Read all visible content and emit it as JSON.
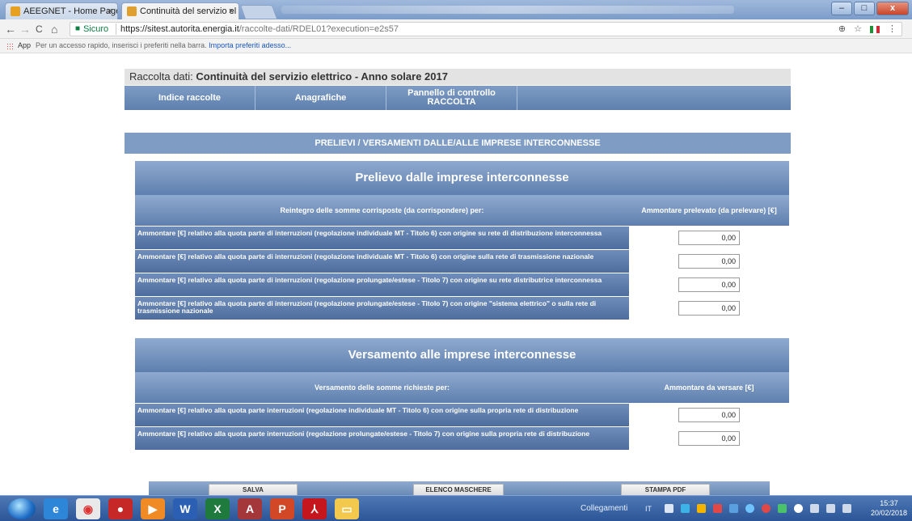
{
  "browser": {
    "tabs": [
      {
        "title": "AEEGNET - Home Page",
        "close": "×"
      },
      {
        "title": "Continuità del servizio el",
        "close": "×"
      }
    ],
    "window_buttons": {
      "minimize": "–",
      "maximize": "□",
      "close": "x"
    },
    "nav": {
      "back": "←",
      "forward": "→",
      "reload": "C",
      "home": "⌂"
    },
    "address": {
      "secure_label": "Sicuro",
      "url_host": "https://sitest.autorita.energia.it",
      "url_path": "/raccolte-dati/RDEL01?execution=e2s57"
    },
    "address_icons": {
      "zoom": "⊕",
      "star": "☆",
      "menu": "⋮"
    },
    "bookmarks": {
      "apps_label": "App",
      "hint_text": "Per un accesso rapido, inserisci i preferiti nella barra.",
      "import_link": "Importa preferiti adesso..."
    }
  },
  "header": {
    "prefix": "Raccolta dati: ",
    "title": "Continuità del servizio elettrico - Anno solare 2017"
  },
  "menu": {
    "items": [
      {
        "label": "Indice raccolte"
      },
      {
        "label": "Anagrafiche"
      },
      {
        "label_line1": "Pannello di controllo",
        "label_line2": "RACCOLTA"
      }
    ]
  },
  "section": {
    "title": "PRELIEVI / VERSAMENTI DALLE/ALLE IMPRESE INTERCONNESSE"
  },
  "prelievo": {
    "title": "Prelievo dalle imprese interconnesse",
    "col_left": "Reintegro delle somme corrisposte (da corrispondere) per:",
    "col_right": "Ammontare prelevato (da prelevare) [€]",
    "rows": [
      {
        "label": "Ammontare [€] relativo alla quota parte di interruzioni (regolazione individuale MT - Titolo 6) con origine su rete di distribuzione interconnessa",
        "value": "0,00"
      },
      {
        "label": "Ammontare [€] relativo alla quota parte di interruzioni (regolazione individuale MT - Titolo 6) con origine sulla rete di trasmissione nazionale",
        "value": "0,00"
      },
      {
        "label": "Ammontare [€] relativo alla quota parte di interruzioni (regolazione prolungate/estese - Titolo 7) con origine su rete distributrice interconnessa",
        "value": "0,00"
      },
      {
        "label": "Ammontare [€] relativo alla quota parte di interruzioni (regolazione prolungate/estese - Titolo 7) con origine \"sistema elettrico\" o sulla rete di trasmissione nazionale",
        "value": "0,00"
      }
    ]
  },
  "versamento": {
    "title": "Versamento alle imprese interconnesse",
    "col_left": "Versamento delle somme richieste per:",
    "col_right": "Ammontare da versare [€]",
    "rows": [
      {
        "label": "Ammontare [€] relativo alla quota parte interruzioni (regolazione individuale MT - Titolo 6) con origine sulla propria rete di distribuzione",
        "value": "0,00"
      },
      {
        "label": "Ammontare [€] relativo alla quota parte interruzioni (regolazione prolungate/estese - Titolo 7) con origine sulla propria rete di distribuzione",
        "value": "0,00"
      }
    ]
  },
  "footer": {
    "save": "SALVA",
    "list": "ELENCO MASCHERE",
    "print": "STAMPA PDF"
  },
  "taskbar": {
    "tray_label": "Collegamenti",
    "lang": "IT",
    "time": "15:37",
    "date": "20/02/2018"
  },
  "colors": {
    "header_blue": "#7e9cc4",
    "row_blue": "#5e7fae"
  }
}
